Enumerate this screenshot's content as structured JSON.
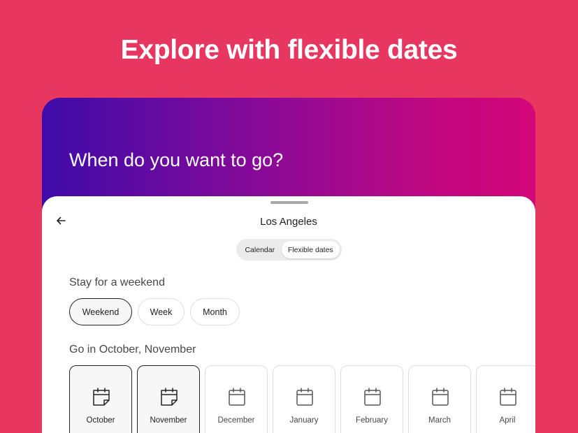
{
  "headline": "Explore with flexible dates",
  "hero_title": "When do you want to go?",
  "sheet": {
    "title": "Los Angeles",
    "back_icon": "back-arrow-icon",
    "tabs": [
      {
        "label": "Calendar",
        "selected": false
      },
      {
        "label": "Flexible dates",
        "selected": true
      }
    ],
    "stay_label": "Stay for a weekend",
    "stay_options": [
      {
        "label": "Weekend",
        "selected": true
      },
      {
        "label": "Week",
        "selected": false
      },
      {
        "label": "Month",
        "selected": false
      }
    ],
    "go_label": "Go in October, November",
    "months": [
      {
        "label": "October",
        "selected": true
      },
      {
        "label": "November",
        "selected": true
      },
      {
        "label": "December",
        "selected": false
      },
      {
        "label": "January",
        "selected": false
      },
      {
        "label": "February",
        "selected": false
      },
      {
        "label": "March",
        "selected": false
      },
      {
        "label": "April",
        "selected": false
      }
    ]
  },
  "colors": {
    "background": "#e73660",
    "gradient_start": "#3e0ba9",
    "gradient_end": "#d30779",
    "selected_border": "#222222"
  }
}
